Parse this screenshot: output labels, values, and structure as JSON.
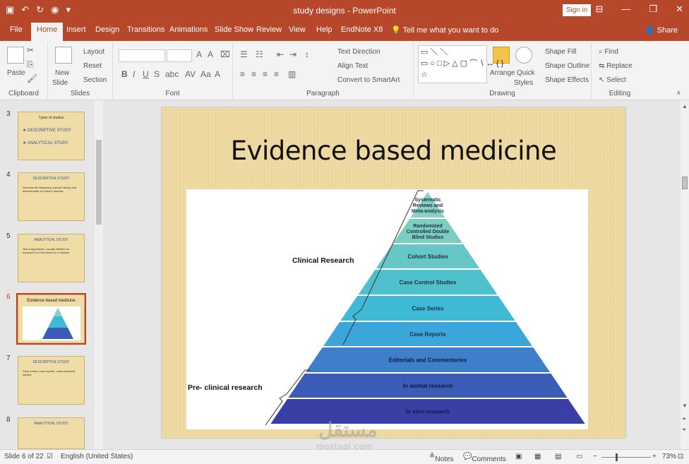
{
  "titlebar": {
    "document_title": "study designs - PowerPoint",
    "signin_label": "Sign in"
  },
  "tabs": [
    {
      "label": "File"
    },
    {
      "label": "Home"
    },
    {
      "label": "Insert"
    },
    {
      "label": "Design"
    },
    {
      "label": "Transitions"
    },
    {
      "label": "Animations"
    },
    {
      "label": "Slide Show"
    },
    {
      "label": "Review"
    },
    {
      "label": "View"
    },
    {
      "label": "Help"
    },
    {
      "label": "EndNote X8"
    }
  ],
  "active_tab": "Home",
  "tell_me": "Tell me what you want to do",
  "share_label": "Share",
  "ribbon": {
    "clipboard": {
      "paste": "Paste",
      "group": "Clipboard"
    },
    "slides": {
      "new_slide_1": "New",
      "new_slide_2": "Slide",
      "layout": "Layout",
      "reset": "Reset",
      "section": "Section",
      "group": "Slides"
    },
    "font": {
      "group": "Font"
    },
    "paragraph": {
      "text_direction": "Text Direction",
      "align_text": "Align Text",
      "convert_smartart": "Convert to SmartArt",
      "group": "Paragraph"
    },
    "drawing": {
      "arrange": "Arrange",
      "quick_styles_1": "Quick",
      "quick_styles_2": "Styles",
      "shape_fill": "Shape Fill",
      "shape_outline": "Shape Outline",
      "shape_effects": "Shape Effects",
      "group": "Drawing"
    },
    "editing": {
      "find": "Find",
      "replace": "Replace",
      "select": "Select",
      "group": "Editing"
    }
  },
  "thumbnails": [
    {
      "num": "3",
      "title": "Types of studies",
      "bullets": [
        "DESCRIPTIVE STUDY",
        "ANALYTICAL STUDY"
      ]
    },
    {
      "num": "4",
      "title": "DESCRIPTIVE STUDY",
      "body": "Describe the frequency, natural history and determinants of a factor, disease"
    },
    {
      "num": "5",
      "title": "ANALYTICAL STUDY",
      "body": "Test a hypothesis, usually whether an exposure is a risk factor for a disease"
    },
    {
      "num": "6",
      "title": "Evidence based medicine",
      "active": true
    },
    {
      "num": "7",
      "title": "DESCRIPTIVE STUDY",
      "body": "Case series, case reports, cross-sectional studies"
    },
    {
      "num": "8",
      "title": "ANALYTICAL STUDY"
    }
  ],
  "slide": {
    "title": "Evidence based medicine",
    "pyramid_levels": [
      {
        "label": "Systematic Reviews and Meta-analysis",
        "color": "#86d1c4"
      },
      {
        "label": "Randomized Controlled Double Blind Studies",
        "color": "#7ccdc2"
      },
      {
        "label": "Cohort Studies",
        "color": "#66c7c6"
      },
      {
        "label": "Case Control Studies",
        "color": "#4fc1cc"
      },
      {
        "label": "Case Series",
        "color": "#3ebad6"
      },
      {
        "label": "Case Reports",
        "color": "#3aa6d9"
      },
      {
        "label": "Editorials and Commentaries",
        "color": "#3e7fc9"
      },
      {
        "label": "In animal research",
        "color": "#3b5cb6"
      },
      {
        "label": "In vitro research",
        "color": "#3a3fa6"
      }
    ],
    "clinical_label": "Clinical Research",
    "preclinical_label": "Pre- clinical research"
  },
  "watermark": {
    "arabic": "مستقل",
    "latin": "mostaql.com"
  },
  "status": {
    "slide_counter": "Slide 6 of 22",
    "language": "English (United States)",
    "notes": "Notes",
    "comments": "Comments",
    "zoom": "73%"
  }
}
